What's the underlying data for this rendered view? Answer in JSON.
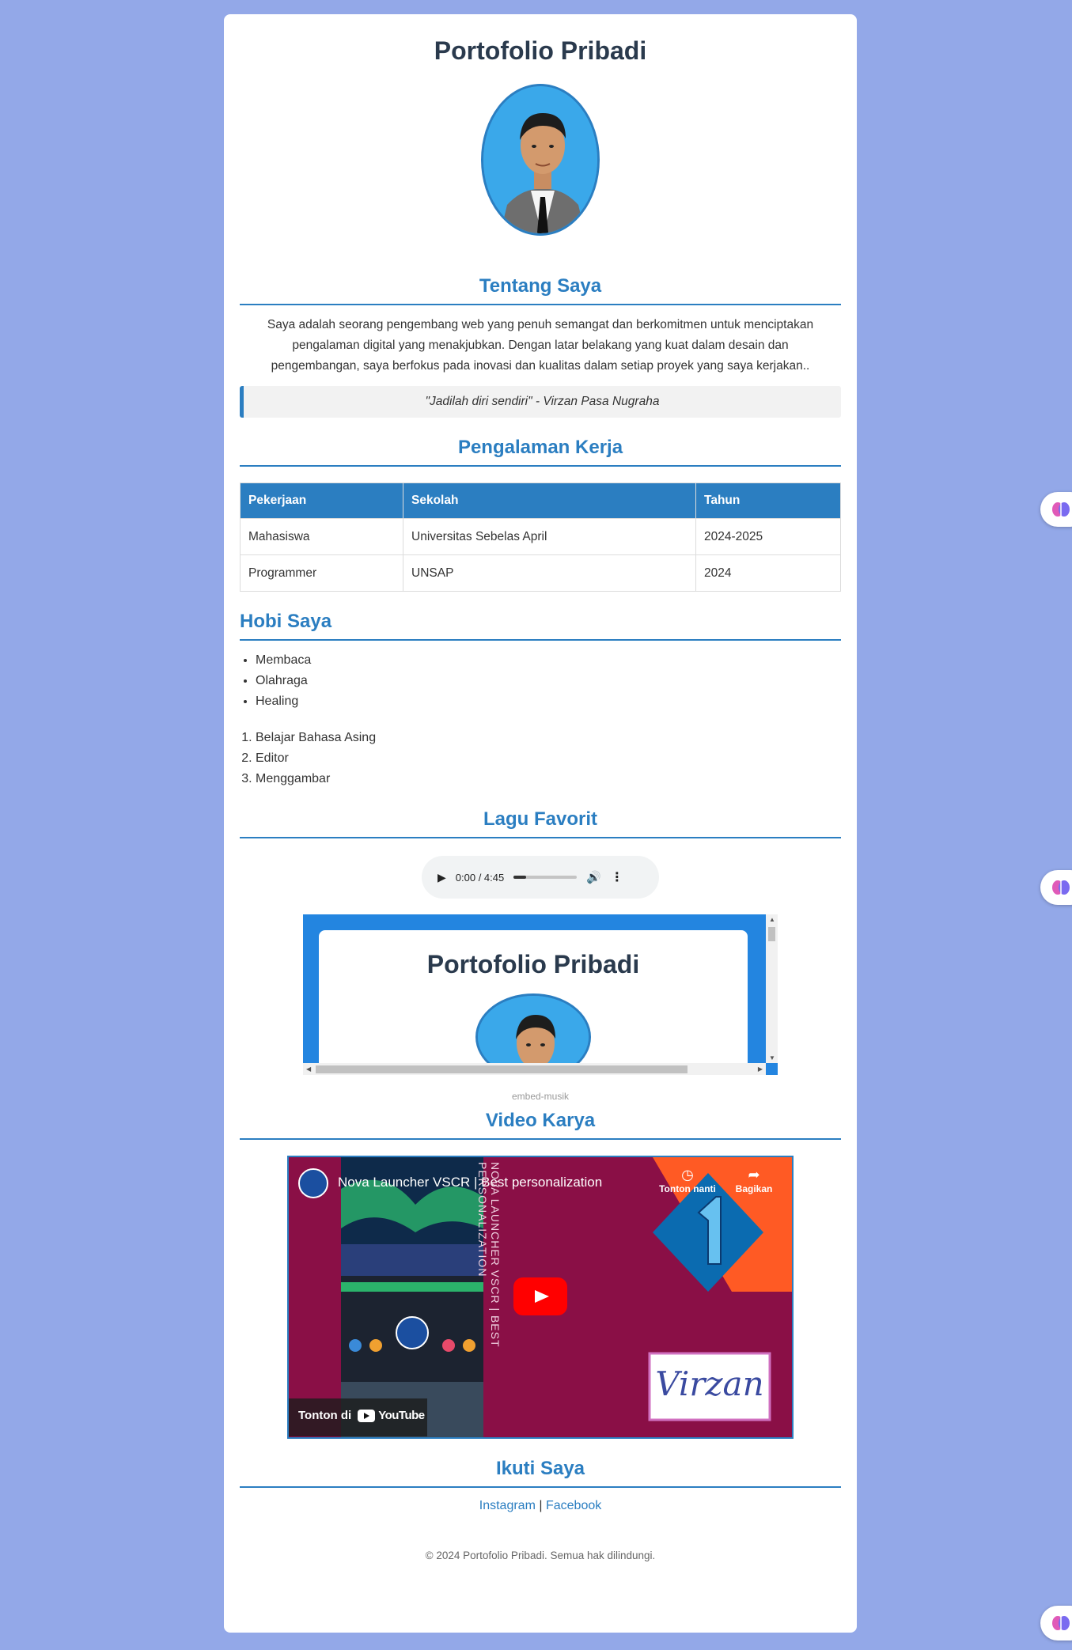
{
  "page_title": "Portofolio Pribadi",
  "about": {
    "title": "Tentang Saya",
    "text": "Saya adalah seorang pengembang web yang penuh semangat dan berkomitmen untuk menciptakan pengalaman digital yang menakjubkan. Dengan latar belakang yang kuat dalam desain dan pengembangan, saya berfokus pada inovasi dan kualitas dalam setiap proyek yang saya kerjakan..",
    "quote": "\"Jadilah diri sendiri\" - Virzan Pasa Nugraha"
  },
  "work": {
    "title": "Pengalaman Kerja",
    "headers": [
      "Pekerjaan",
      "Sekolah",
      "Tahun"
    ],
    "rows": [
      [
        "Mahasiswa",
        "Universitas Sebelas April",
        "2024-2025"
      ],
      [
        "Programmer",
        "UNSAP",
        "2024"
      ]
    ]
  },
  "hobbies": {
    "title": "Hobi Saya",
    "unordered": [
      "Membaca",
      "Olahraga",
      "Healing"
    ],
    "ordered": [
      "Belajar Bahasa Asing",
      "Editor",
      "Menggambar"
    ]
  },
  "music": {
    "title": "Lagu Favorit",
    "audio_time": "0:00 / 4:45",
    "audio_progress": 0.2,
    "embed_title": "Portofolio Pribadi",
    "embed_caption": "embed-musik"
  },
  "video": {
    "title": "Video Karya",
    "video_title": "Nova Launcher VSCR | Best personalization",
    "watch_later": "Tonton nanti",
    "share": "Bagikan",
    "watch_on": "Tonton di",
    "youtube": "YouTube",
    "vertical_text": "NOVA LAUNCHER VSCR | BEST PERSONALIZATION",
    "signature": "Virzan"
  },
  "follow": {
    "title": "Ikuti Saya",
    "instagram": "Instagram",
    "separator": "|",
    "facebook": "Facebook"
  },
  "copyright": "© 2024 Portofolio Pribadi. Semua hak dilindungi.",
  "colors": {
    "background": "#93a8e8",
    "accent": "#2b7ec1",
    "video_bg": "#8a0f46"
  }
}
